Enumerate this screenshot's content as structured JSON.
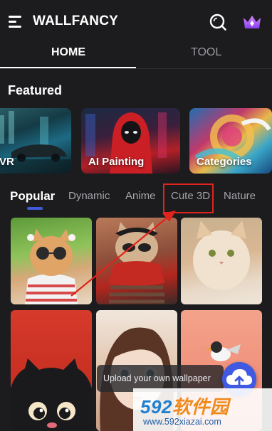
{
  "header": {
    "title": "WALLFANCY",
    "menu_icon": "menu-icon",
    "search_icon": "search-icon",
    "vip_icon": "crown-icon"
  },
  "main_tabs": [
    {
      "label": "HOME",
      "active": true
    },
    {
      "label": "TOOL",
      "active": false
    }
  ],
  "featured": {
    "title": "Featured",
    "cards": [
      {
        "label": "VR"
      },
      {
        "label": "AI Painting"
      },
      {
        "label": "Categories"
      }
    ]
  },
  "categories": [
    {
      "label": "Popular",
      "active": true
    },
    {
      "label": "Dynamic",
      "active": false
    },
    {
      "label": "Anime",
      "active": false
    },
    {
      "label": "Cute 3D",
      "active": false,
      "highlighted": true
    },
    {
      "label": "Nature",
      "active": false
    }
  ],
  "wallpapers": [
    {
      "subject": "cat-with-sunglasses"
    },
    {
      "subject": "cat-with-red-scarf"
    },
    {
      "subject": "fluffy-cat"
    },
    {
      "subject": "black-cat"
    },
    {
      "subject": "anime-girl"
    },
    {
      "subject": "bird-on-pink"
    }
  ],
  "upload": {
    "toast_text": "Upload your own wallpaper",
    "fab_icon": "cloud-upload-icon"
  },
  "watermark": {
    "main_num": "592",
    "main_cn": "软件园",
    "sub": "www.592xiazai.com"
  },
  "colors": {
    "background": "#1c1c1e",
    "accent": "#3f5ae0",
    "highlight": "#e0241b",
    "vip": "#a855f7"
  }
}
